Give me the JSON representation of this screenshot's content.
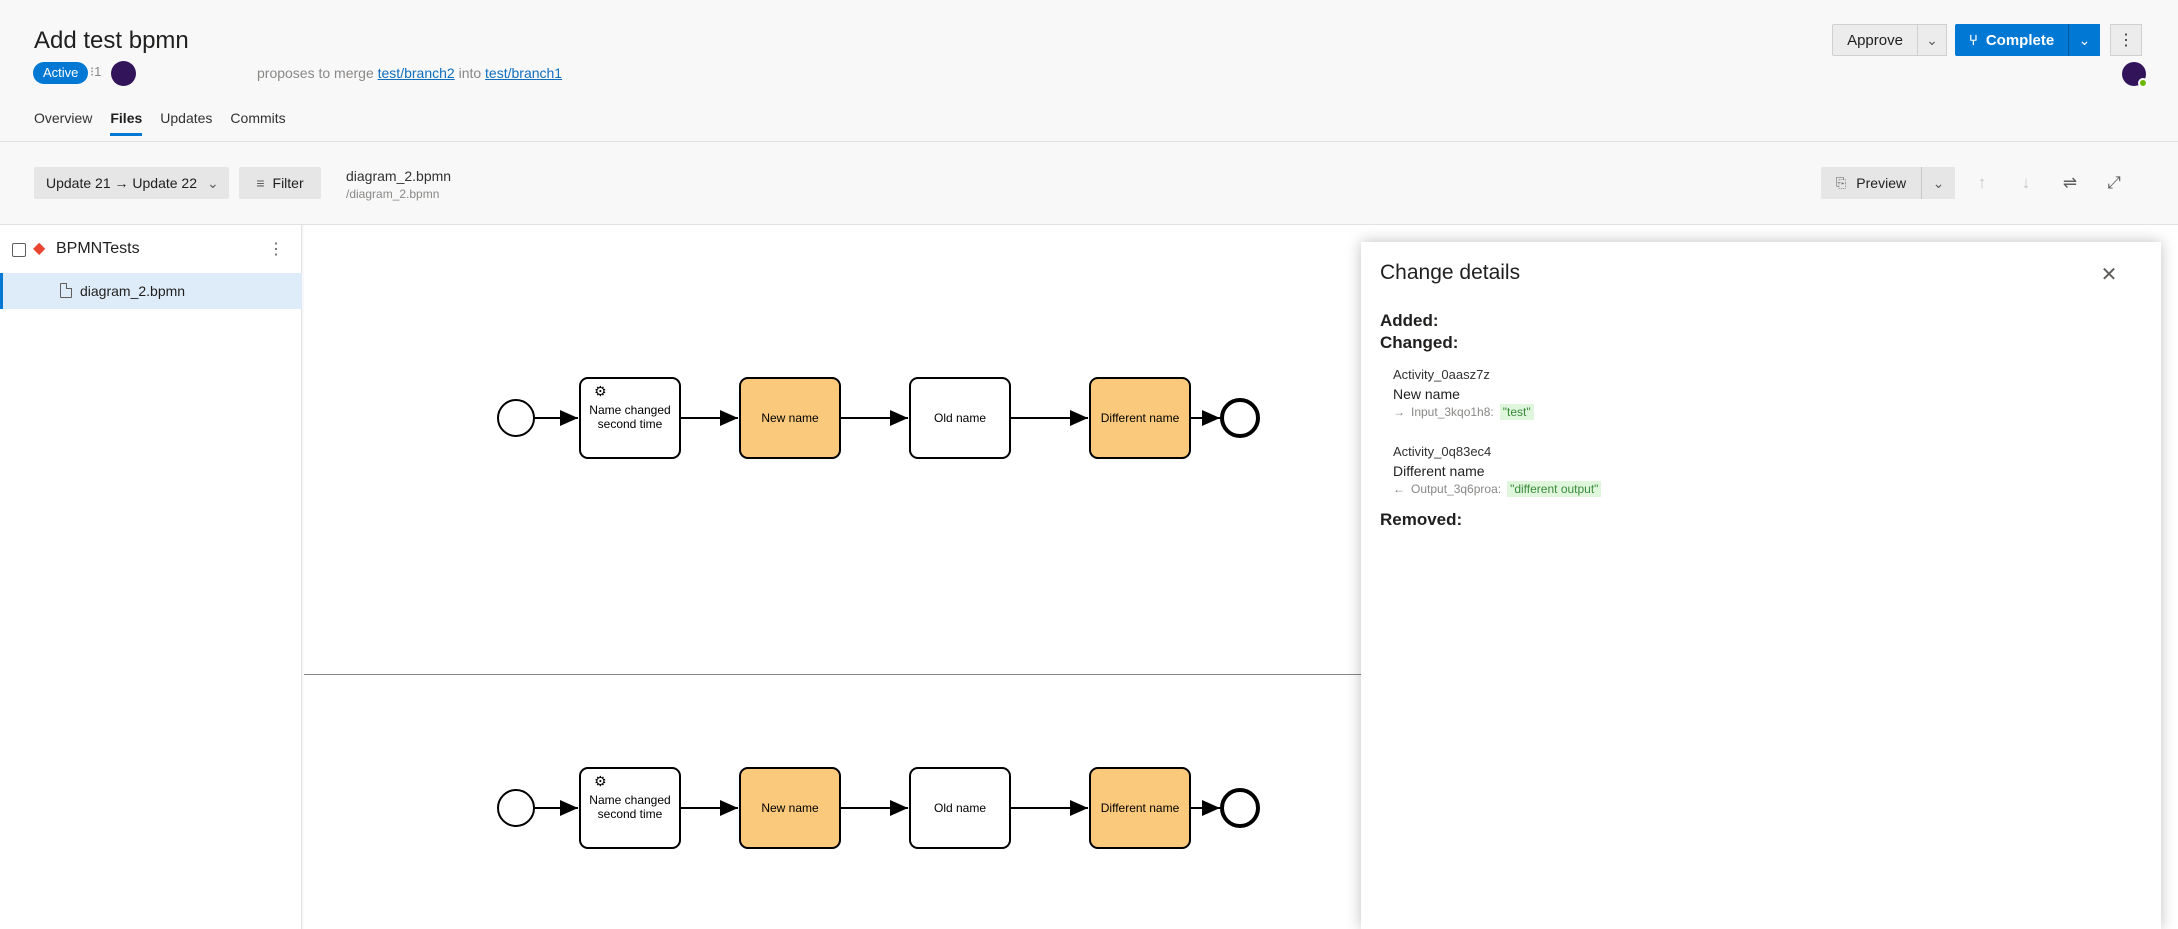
{
  "pr": {
    "title": "Add test bpmn",
    "status": "Active",
    "reviewer_count": "⁝1",
    "merge_prefix": "proposes to merge",
    "source_branch": "test/branch2",
    "merge_middle": "into",
    "target_branch": "test/branch1"
  },
  "tabs": [
    "Overview",
    "Files",
    "Updates",
    "Commits"
  ],
  "actions": {
    "approve": "Approve",
    "complete": "Complete"
  },
  "toolbar": {
    "update_range": "Update 21 → Update 22",
    "filter": "Filter",
    "file_name": "diagram_2.bpmn",
    "file_path": "/diagram_2.bpmn",
    "preview": "Preview"
  },
  "tree": {
    "repo": "BPMNTests",
    "file": "diagram_2.bpmn"
  },
  "diagram": {
    "tasks": [
      "Name changed second time",
      "New name",
      "Old name",
      "Different name"
    ],
    "highlight_color": "#fbc97c"
  },
  "panel": {
    "title": "Change details",
    "added": "Added:",
    "changed": "Changed:",
    "removed": "Removed:",
    "changes": [
      {
        "id": "Activity_0aasz7z",
        "name": "New name",
        "io_label": "Input_3kqo1h8:",
        "io_arrow": "→",
        "value": "\"test\""
      },
      {
        "id": "Activity_0q83ec4",
        "name": "Different name",
        "io_label": "Output_3q6proa:",
        "io_arrow": "←",
        "value": "\"different output\""
      }
    ]
  }
}
